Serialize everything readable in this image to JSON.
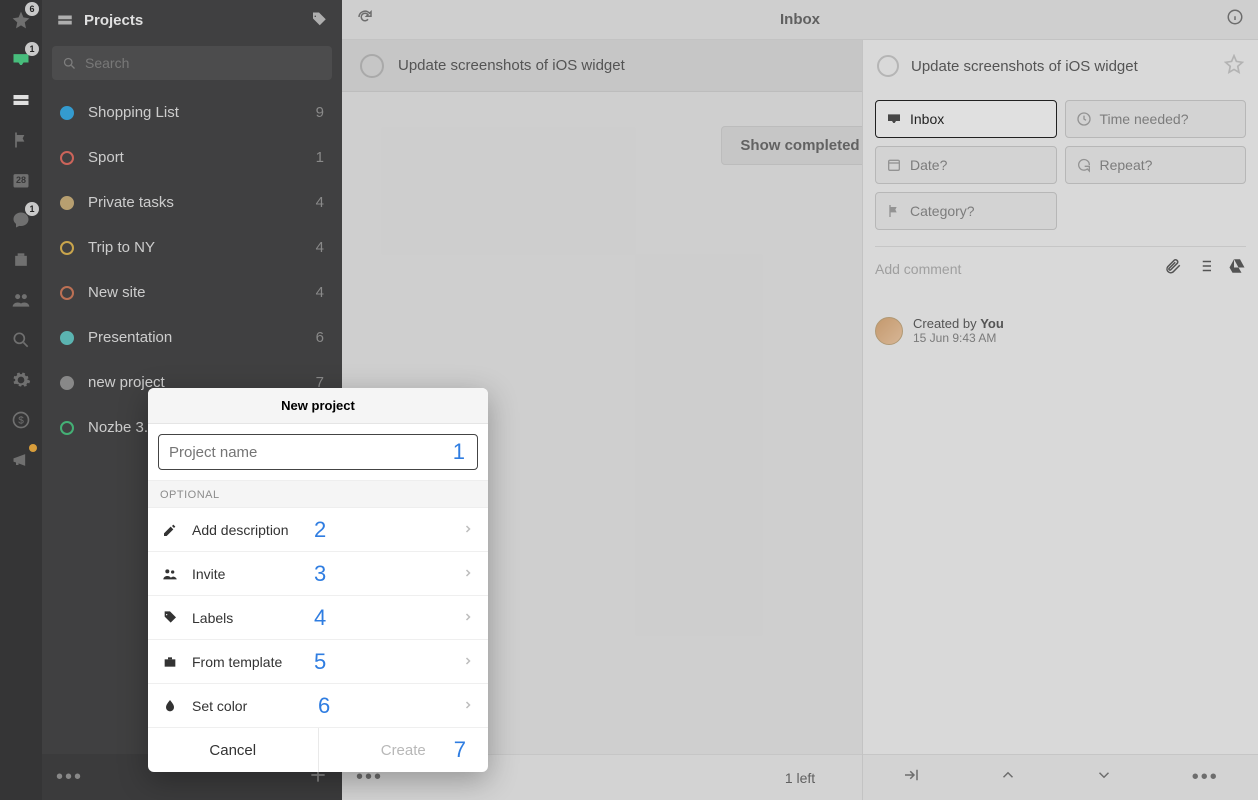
{
  "rail_badges": {
    "star": "6",
    "inbox": "1",
    "calendar": "28",
    "chat": "1"
  },
  "sidebar": {
    "title": "Projects",
    "search_placeholder": "Search",
    "projects": [
      {
        "name": "Shopping List",
        "count": "9",
        "color": "#1aa3e8",
        "fill": true
      },
      {
        "name": "Sport",
        "count": "1",
        "color": "#e45a4c",
        "fill": false
      },
      {
        "name": "Private tasks",
        "count": "4",
        "color": "#c9a96a",
        "fill": true
      },
      {
        "name": "Trip to NY",
        "count": "4",
        "color": "#e0b03a",
        "fill": false
      },
      {
        "name": "New site",
        "count": "4",
        "color": "#cf6a45",
        "fill": false
      },
      {
        "name": "Presentation",
        "count": "6",
        "color": "#4ec5c0",
        "fill": true
      },
      {
        "name": "new project",
        "count": "7",
        "color": "#8a8a8a",
        "fill": true
      },
      {
        "name": "Nozbe 3.",
        "count": "",
        "color": "#2fbf71",
        "fill": false
      }
    ]
  },
  "main": {
    "header": "Inbox",
    "task": "Update screenshots of iOS widget",
    "show_completed": "Show completed",
    "footer_count": "1 left"
  },
  "detail": {
    "title": "Update screenshots of iOS widget",
    "chips": {
      "inbox": "Inbox",
      "time": "Time needed?",
      "date": "Date?",
      "repeat": "Repeat?",
      "category": "Category?"
    },
    "comment_placeholder": "Add comment",
    "created_prefix": "Created by ",
    "created_by": "You",
    "created_time": "15 Jun 9:43 AM"
  },
  "modal": {
    "title": "New project",
    "name_placeholder": "Project name",
    "optional_label": "OPTIONAL",
    "rows": {
      "desc": "Add description",
      "invite": "Invite",
      "labels": "Labels",
      "template": "From template",
      "color": "Set color"
    },
    "cancel": "Cancel",
    "create": "Create",
    "annotations": [
      "1",
      "2",
      "3",
      "4",
      "5",
      "6",
      "7"
    ]
  }
}
